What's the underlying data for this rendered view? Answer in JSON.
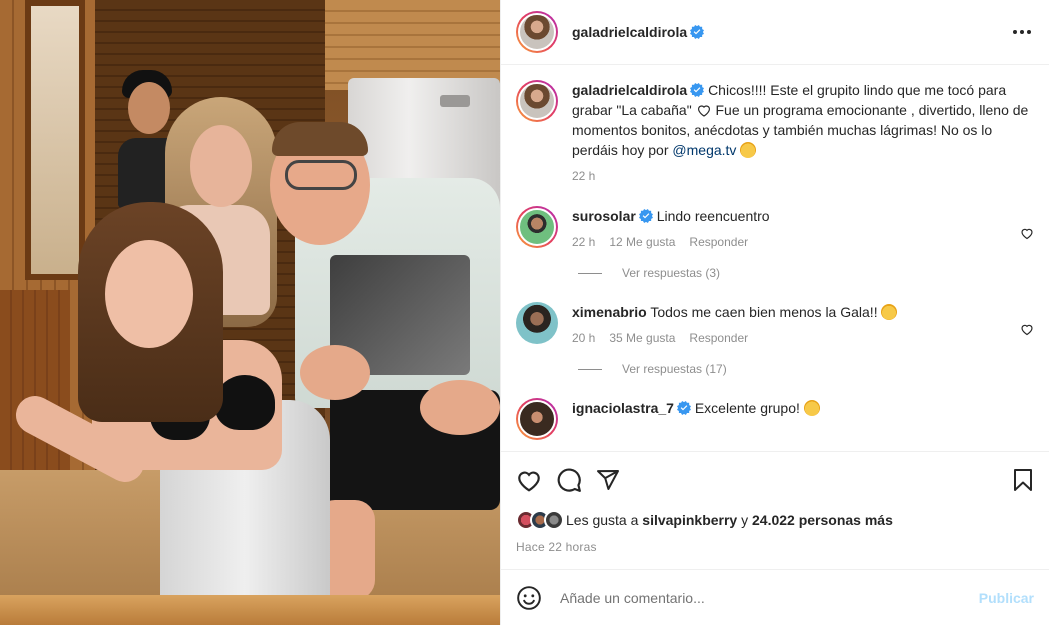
{
  "header": {
    "username": "galadrielcaldirola"
  },
  "caption": {
    "username": "galadrielcaldirola",
    "text_1": "Chicos!!!! Este el grupito lindo que me tocó para grabar \"La cabaña\"",
    "text_2": "Fue un programa emocionante , divertido, lleno de momentos bonitos, anécdotas y también muchas lágrimas! No os lo perdáis hoy por",
    "mention": "@mega.tv",
    "time": "22 h"
  },
  "comments": [
    {
      "username": "surosolar",
      "verified": true,
      "text": "Lindo reencuentro",
      "time": "22 h",
      "likes": "12 Me gusta",
      "reply": "Responder",
      "view_replies": "Ver respuestas (3)"
    },
    {
      "username": "ximenabrio",
      "verified": false,
      "text": "Todos me caen bien menos la Gala!!",
      "time": "20 h",
      "likes": "35 Me gusta",
      "reply": "Responder",
      "view_replies": "Ver respuestas (17)"
    },
    {
      "username": "ignaciolastra_7",
      "verified": true,
      "text": "Excelente grupo!"
    }
  ],
  "likes": {
    "prefix": "Les gusta a",
    "user": "silvapinkberry",
    "connector": "y",
    "others": "24.022 personas más"
  },
  "timestamp": "Hace 22 horas",
  "add_comment": {
    "placeholder": "Añade un comentario...",
    "publish": "Publicar"
  },
  "colors": {
    "verified": "#3897f0",
    "link": "#00376b",
    "publish_disabled": "#b2dffc"
  },
  "icons": [
    "more-icon",
    "heart-icon",
    "comment-icon",
    "share-icon",
    "bookmark-icon",
    "emoji-icon",
    "verified-icon"
  ]
}
